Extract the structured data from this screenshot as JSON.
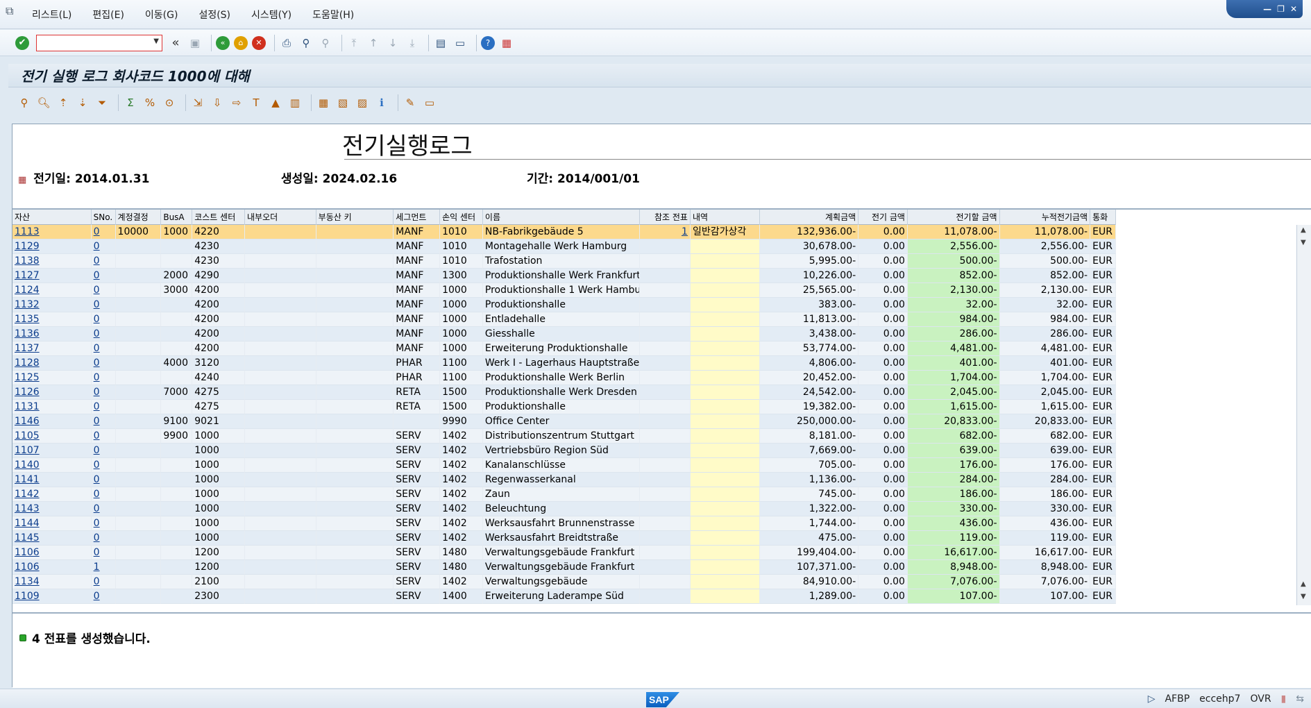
{
  "menu": {
    "items": [
      "리스트(L)",
      "편집(E)",
      "이동(G)",
      "설정(S)",
      "시스템(Y)",
      "도움말(H)"
    ]
  },
  "toolbar": {
    "command_value": "",
    "icons": [
      "check-icon",
      "save-icon",
      "back-icon",
      "exit-icon",
      "cancel-icon",
      "print-icon",
      "find-icon",
      "find-next-icon",
      "first-page-icon",
      "prev-page-icon",
      "next-page-icon",
      "last-page-icon",
      "new-session-icon",
      "shortcut-icon",
      "help-icon",
      "customize-icon"
    ]
  },
  "title": "전기 실행 로그 회사코드 1000에 대해",
  "report": {
    "title": "전기실행로그",
    "posting_date_label": "전기일:",
    "posting_date": "2014.01.31",
    "created_label": "생성일:",
    "created": "2024.02.16",
    "period_label": "기간:",
    "period": "2014/001/01"
  },
  "table": {
    "headers": [
      "자산",
      "SNo.",
      "계정결정",
      "BusA",
      "코스트 센터",
      "내부오더",
      "부동산 키",
      "세그먼트",
      "손익 센터",
      "이름",
      "참조 전표",
      "내역",
      "계획금액",
      "전기 금액",
      "전기할 금액",
      "누적전기금액",
      "통화"
    ],
    "rows": [
      [
        "1113",
        "0",
        "10000",
        "1000",
        "4220",
        "",
        "",
        "MANF",
        "1010",
        "NB-Fabrikgebäude 5",
        "1",
        "일반감가상각",
        "132,936.00-",
        "0.00",
        "11,078.00-",
        "11,078.00-",
        "EUR"
      ],
      [
        "1129",
        "0",
        "",
        "",
        "4230",
        "",
        "",
        "MANF",
        "1010",
        "Montagehalle Werk Hamburg",
        "",
        "",
        "30,678.00-",
        "0.00",
        "2,556.00-",
        "2,556.00-",
        "EUR"
      ],
      [
        "1138",
        "0",
        "",
        "",
        "4230",
        "",
        "",
        "MANF",
        "1010",
        "Trafostation",
        "",
        "",
        "5,995.00-",
        "0.00",
        "500.00-",
        "500.00-",
        "EUR"
      ],
      [
        "1127",
        "0",
        "",
        "2000",
        "4290",
        "",
        "",
        "MANF",
        "1300",
        "Produktionshalle Werk Frankfurt",
        "",
        "",
        "10,226.00-",
        "0.00",
        "852.00-",
        "852.00-",
        "EUR"
      ],
      [
        "1124",
        "0",
        "",
        "3000",
        "4200",
        "",
        "",
        "MANF",
        "1000",
        "Produktionshalle 1 Werk Hamburg",
        "",
        "",
        "25,565.00-",
        "0.00",
        "2,130.00-",
        "2,130.00-",
        "EUR"
      ],
      [
        "1132",
        "0",
        "",
        "",
        "4200",
        "",
        "",
        "MANF",
        "1000",
        "Produktionshalle",
        "",
        "",
        "383.00-",
        "0.00",
        "32.00-",
        "32.00-",
        "EUR"
      ],
      [
        "1135",
        "0",
        "",
        "",
        "4200",
        "",
        "",
        "MANF",
        "1000",
        "Entladehalle",
        "",
        "",
        "11,813.00-",
        "0.00",
        "984.00-",
        "984.00-",
        "EUR"
      ],
      [
        "1136",
        "0",
        "",
        "",
        "4200",
        "",
        "",
        "MANF",
        "1000",
        "Giesshalle",
        "",
        "",
        "3,438.00-",
        "0.00",
        "286.00-",
        "286.00-",
        "EUR"
      ],
      [
        "1137",
        "0",
        "",
        "",
        "4200",
        "",
        "",
        "MANF",
        "1000",
        "Erweiterung Produktionshalle",
        "",
        "",
        "53,774.00-",
        "0.00",
        "4,481.00-",
        "4,481.00-",
        "EUR"
      ],
      [
        "1128",
        "0",
        "",
        "4000",
        "3120",
        "",
        "",
        "PHAR",
        "1100",
        "Werk I - Lagerhaus Hauptstraße",
        "",
        "",
        "4,806.00-",
        "0.00",
        "401.00-",
        "401.00-",
        "EUR"
      ],
      [
        "1125",
        "0",
        "",
        "",
        "4240",
        "",
        "",
        "PHAR",
        "1100",
        "Produktionshalle Werk Berlin",
        "",
        "",
        "20,452.00-",
        "0.00",
        "1,704.00-",
        "1,704.00-",
        "EUR"
      ],
      [
        "1126",
        "0",
        "",
        "7000",
        "4275",
        "",
        "",
        "RETA",
        "1500",
        "Produktionshalle Werk Dresden",
        "",
        "",
        "24,542.00-",
        "0.00",
        "2,045.00-",
        "2,045.00-",
        "EUR"
      ],
      [
        "1131",
        "0",
        "",
        "",
        "4275",
        "",
        "",
        "RETA",
        "1500",
        "Produktionshalle",
        "",
        "",
        "19,382.00-",
        "0.00",
        "1,615.00-",
        "1,615.00-",
        "EUR"
      ],
      [
        "1146",
        "0",
        "",
        "9100",
        "9021",
        "",
        "",
        "",
        "9990",
        "Office Center",
        "",
        "",
        "250,000.00-",
        "0.00",
        "20,833.00-",
        "20,833.00-",
        "EUR"
      ],
      [
        "1105",
        "0",
        "",
        "9900",
        "1000",
        "",
        "",
        "SERV",
        "1402",
        "Distributionszentrum Stuttgart",
        "",
        "",
        "8,181.00-",
        "0.00",
        "682.00-",
        "682.00-",
        "EUR"
      ],
      [
        "1107",
        "0",
        "",
        "",
        "1000",
        "",
        "",
        "SERV",
        "1402",
        "Vertriebsbüro Region Süd",
        "",
        "",
        "7,669.00-",
        "0.00",
        "639.00-",
        "639.00-",
        "EUR"
      ],
      [
        "1140",
        "0",
        "",
        "",
        "1000",
        "",
        "",
        "SERV",
        "1402",
        "Kanalanschlüsse",
        "",
        "",
        "705.00-",
        "0.00",
        "176.00-",
        "176.00-",
        "EUR"
      ],
      [
        "1141",
        "0",
        "",
        "",
        "1000",
        "",
        "",
        "SERV",
        "1402",
        "Regenwasserkanal",
        "",
        "",
        "1,136.00-",
        "0.00",
        "284.00-",
        "284.00-",
        "EUR"
      ],
      [
        "1142",
        "0",
        "",
        "",
        "1000",
        "",
        "",
        "SERV",
        "1402",
        "Zaun",
        "",
        "",
        "745.00-",
        "0.00",
        "186.00-",
        "186.00-",
        "EUR"
      ],
      [
        "1143",
        "0",
        "",
        "",
        "1000",
        "",
        "",
        "SERV",
        "1402",
        "Beleuchtung",
        "",
        "",
        "1,322.00-",
        "0.00",
        "330.00-",
        "330.00-",
        "EUR"
      ],
      [
        "1144",
        "0",
        "",
        "",
        "1000",
        "",
        "",
        "SERV",
        "1402",
        "Werksausfahrt Brunnenstrasse",
        "",
        "",
        "1,744.00-",
        "0.00",
        "436.00-",
        "436.00-",
        "EUR"
      ],
      [
        "1145",
        "0",
        "",
        "",
        "1000",
        "",
        "",
        "SERV",
        "1402",
        "Werksausfahrt Breidtstraße",
        "",
        "",
        "475.00-",
        "0.00",
        "119.00-",
        "119.00-",
        "EUR"
      ],
      [
        "1106",
        "0",
        "",
        "",
        "1200",
        "",
        "",
        "SERV",
        "1480",
        "Verwaltungsgebäude Frankfurt",
        "",
        "",
        "199,404.00-",
        "0.00",
        "16,617.00-",
        "16,617.00-",
        "EUR"
      ],
      [
        "1106",
        "1",
        "",
        "",
        "1200",
        "",
        "",
        "SERV",
        "1480",
        "Verwaltungsgebäude Frankfurt",
        "",
        "",
        "107,371.00-",
        "0.00",
        "8,948.00-",
        "8,948.00-",
        "EUR"
      ],
      [
        "1134",
        "0",
        "",
        "",
        "2100",
        "",
        "",
        "SERV",
        "1402",
        "Verwaltungsgebäude",
        "",
        "",
        "84,910.00-",
        "0.00",
        "7,076.00-",
        "7,076.00-",
        "EUR"
      ],
      [
        "1109",
        "0",
        "",
        "",
        "2300",
        "",
        "",
        "SERV",
        "1400",
        "Erweiterung Laderampe Süd",
        "",
        "",
        "1,289.00-",
        "0.00",
        "107.00-",
        "107.00-",
        "EUR"
      ]
    ]
  },
  "message": "4 전표를 생성했습니다.",
  "status": {
    "transaction": "AFBP",
    "system": "eccehp7",
    "mode": "OVR"
  }
}
